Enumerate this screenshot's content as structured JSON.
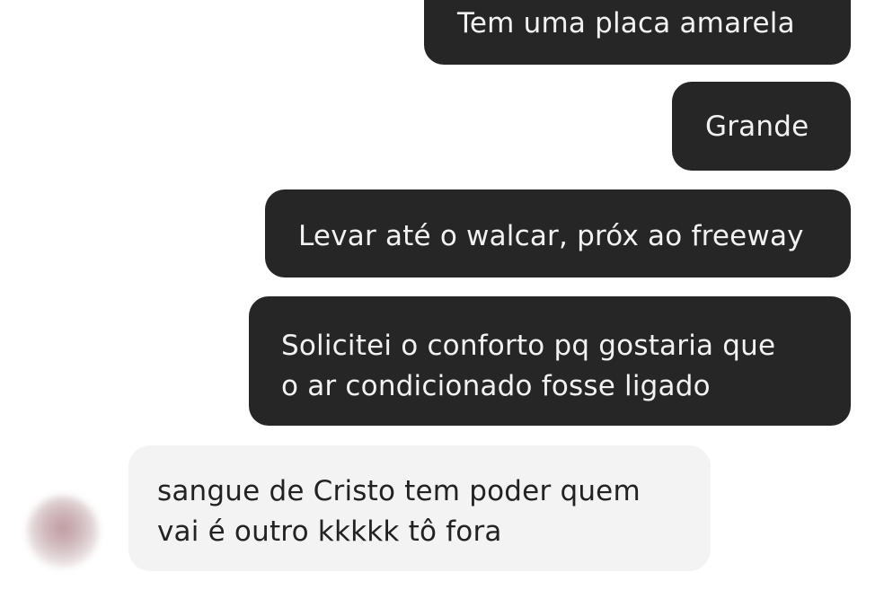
{
  "conversation": {
    "messages": [
      {
        "sender": "me",
        "lines": [
          "Tem uma placa amarela"
        ]
      },
      {
        "sender": "me",
        "lines": [
          "Grande"
        ]
      },
      {
        "sender": "me",
        "lines": [
          "Levar até o walcar, próx ao freeway"
        ]
      },
      {
        "sender": "me",
        "lines": [
          "Solicitei o conforto pq gostaria que",
          "o ar condicionado fosse ligado"
        ]
      },
      {
        "sender": "other",
        "lines": [
          "sangue de Cristo tem poder quem",
          "vai é outro kkkkk tô fora"
        ]
      }
    ]
  },
  "colors": {
    "page_background": "#ffffff",
    "sent_bubble": "#262626",
    "sent_text": "#f2f2f2",
    "received_bubble": "#f3f3f3",
    "received_text": "#222222"
  },
  "icons": {
    "contact_avatar": "blurred-avatar"
  }
}
